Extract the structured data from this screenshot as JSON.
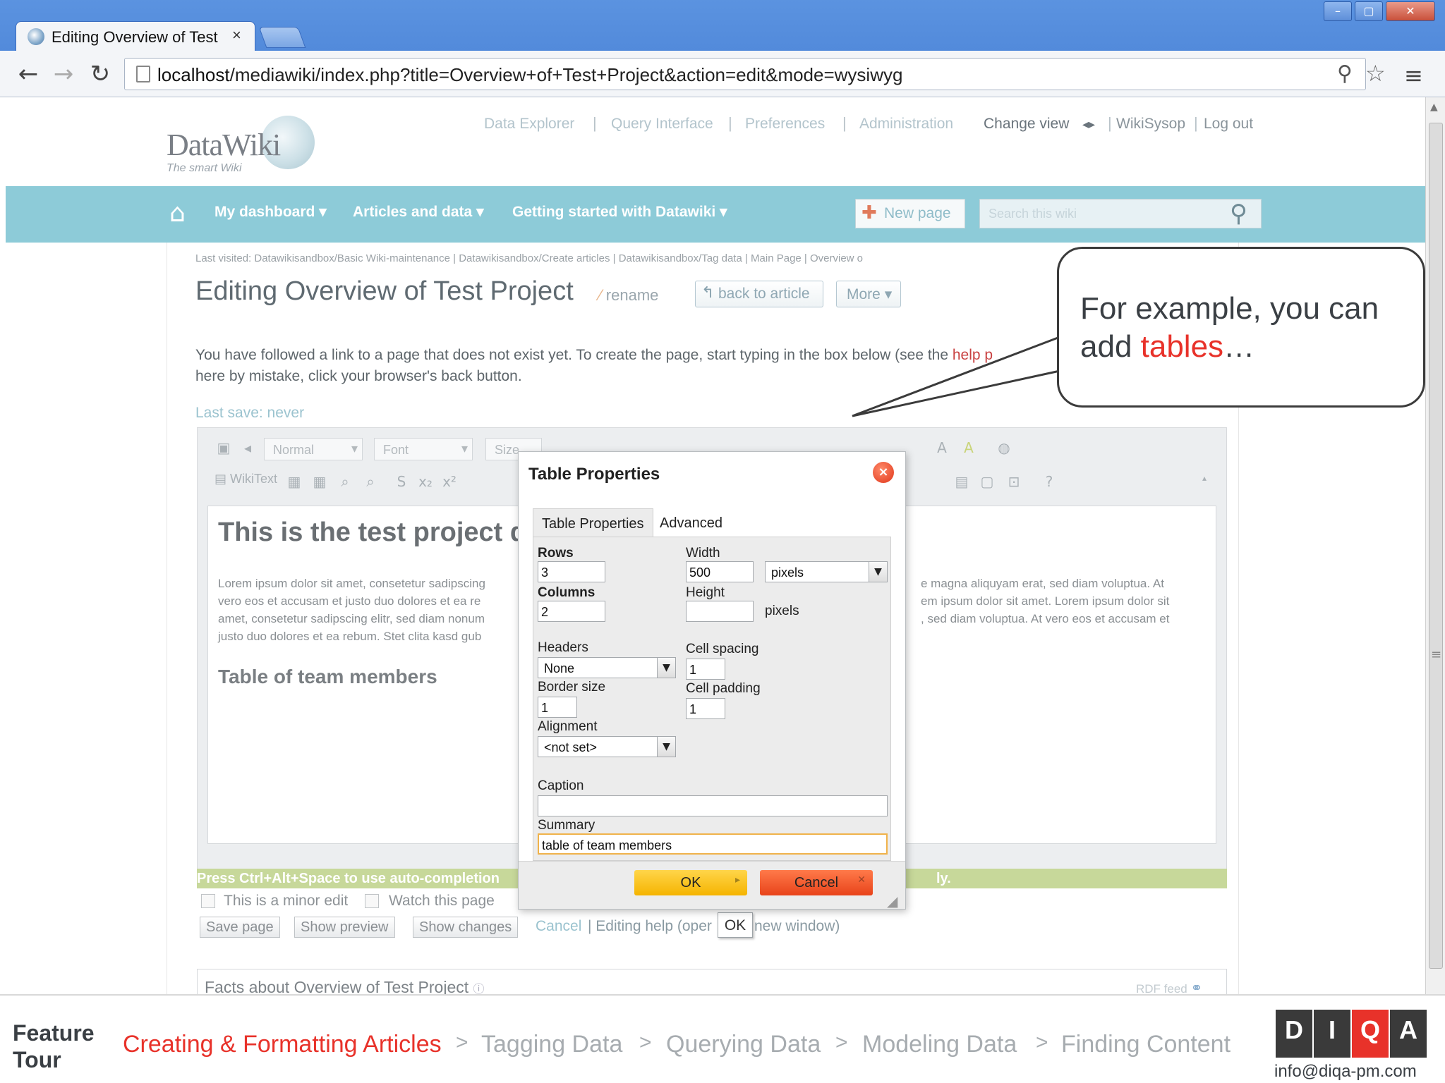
{
  "browser": {
    "tab_title": "Editing Overview of Test P",
    "url_host": "localhost",
    "url_path": "/mediawiki/index.php?title=Overview+of+Test+Project&action=edit&mode=wysiwyg"
  },
  "site": {
    "logo_text": "DataWiki",
    "logo_sub": "The smart Wiki",
    "top_links": [
      "Data Explorer",
      "Query Interface",
      "Preferences",
      "Administration"
    ],
    "change_view": "Change view",
    "user": "WikiSysop",
    "logout": "Log out",
    "nav": [
      "My dashboard",
      "Articles and data",
      "Getting started with Datawiki"
    ],
    "new_page": "New page",
    "search_placeholder": "Search this wiki"
  },
  "page": {
    "last_visited": "Last visited:   Datawikisandbox/Basic Wiki-maintenance   |   Datawikisandbox/Create articles   |   Datawikisandbox/Tag data   |   Main Page   |   Overview o",
    "title": "Editing Overview of Test Project",
    "rename": "rename",
    "back_to_article": "back to article",
    "more": "More",
    "info_line1": "You have followed a link to a page that does not exist yet. To create the page, start typing in the box below (see the ",
    "info_help": "help p",
    "info_line2": "here by mistake, click your browser's back button.",
    "last_save": "Last save: never"
  },
  "editor": {
    "format": "Normal",
    "font": "Font",
    "size": "Size",
    "wikitext": "WikiText",
    "heading": "This is the test project d",
    "para_left": [
      "Lorem ipsum dolor sit amet, consetetur sadipscing",
      "vero eos et accusam et justo duo dolores et ea re",
      "amet, consetetur sadipscing elitr, sed diam nonum",
      "justo duo dolores et ea rebum. Stet clita kasd gub"
    ],
    "para_right": [
      "e magna aliquyam erat, sed diam voluptua. At",
      "em ipsum dolor sit amet. Lorem ipsum dolor sit",
      ", sed diam voluptua. At vero eos et accusam et"
    ],
    "subheading": "Table of team members",
    "autocomplete": "Press Ctrl+Alt+Space to use auto-completion",
    "autocomplete_end": "ly."
  },
  "edit_actions": {
    "minor_edit": "This is a minor edit",
    "watch": "Watch this page",
    "save": "Save page",
    "preview": "Show preview",
    "changes": "Show changes",
    "cancel": "Cancel",
    "help": "| Editing help (oper",
    "help_end": "new window)",
    "ok_tooltip": "OK"
  },
  "facts": {
    "title": "Facts about Overview of Test Project",
    "rdf": "RDF feed"
  },
  "dialog": {
    "title": "Table Properties",
    "tab1": "Table Properties",
    "tab2": "Advanced",
    "rows_label": "Rows",
    "rows": "3",
    "columns_label": "Columns",
    "columns": "2",
    "width_label": "Width",
    "width": "500",
    "width_unit": "pixels",
    "height_label": "Height",
    "height": "",
    "height_unit": "pixels",
    "headers_label": "Headers",
    "headers": "None",
    "cell_spacing_label": "Cell spacing",
    "cell_spacing": "1",
    "border_label": "Border size",
    "border": "1",
    "cell_padding_label": "Cell padding",
    "cell_padding": "1",
    "alignment_label": "Alignment",
    "alignment": "<not set>",
    "caption_label": "Caption",
    "caption": "",
    "summary_label": "Summary",
    "summary": "table of team members",
    "ok": "OK",
    "cancel": "Cancel"
  },
  "callout": {
    "text_before": "For example, you can add ",
    "highlight": "tables",
    "text_after": "…"
  },
  "footer": {
    "feature_tour": "Feature Tour",
    "steps": [
      "Creating & Formatting Articles",
      "Tagging Data",
      "Querying Data",
      "Modeling Data",
      "Finding Content"
    ],
    "logo_letters": [
      "D",
      "I",
      "Q",
      "A"
    ],
    "email": "info@diqa-pm.com"
  },
  "colors": {
    "navbar": "#8dcbd8",
    "accent_red": "#e8322a",
    "ok_button": "#f5b400",
    "cancel_button": "#e8431a"
  }
}
